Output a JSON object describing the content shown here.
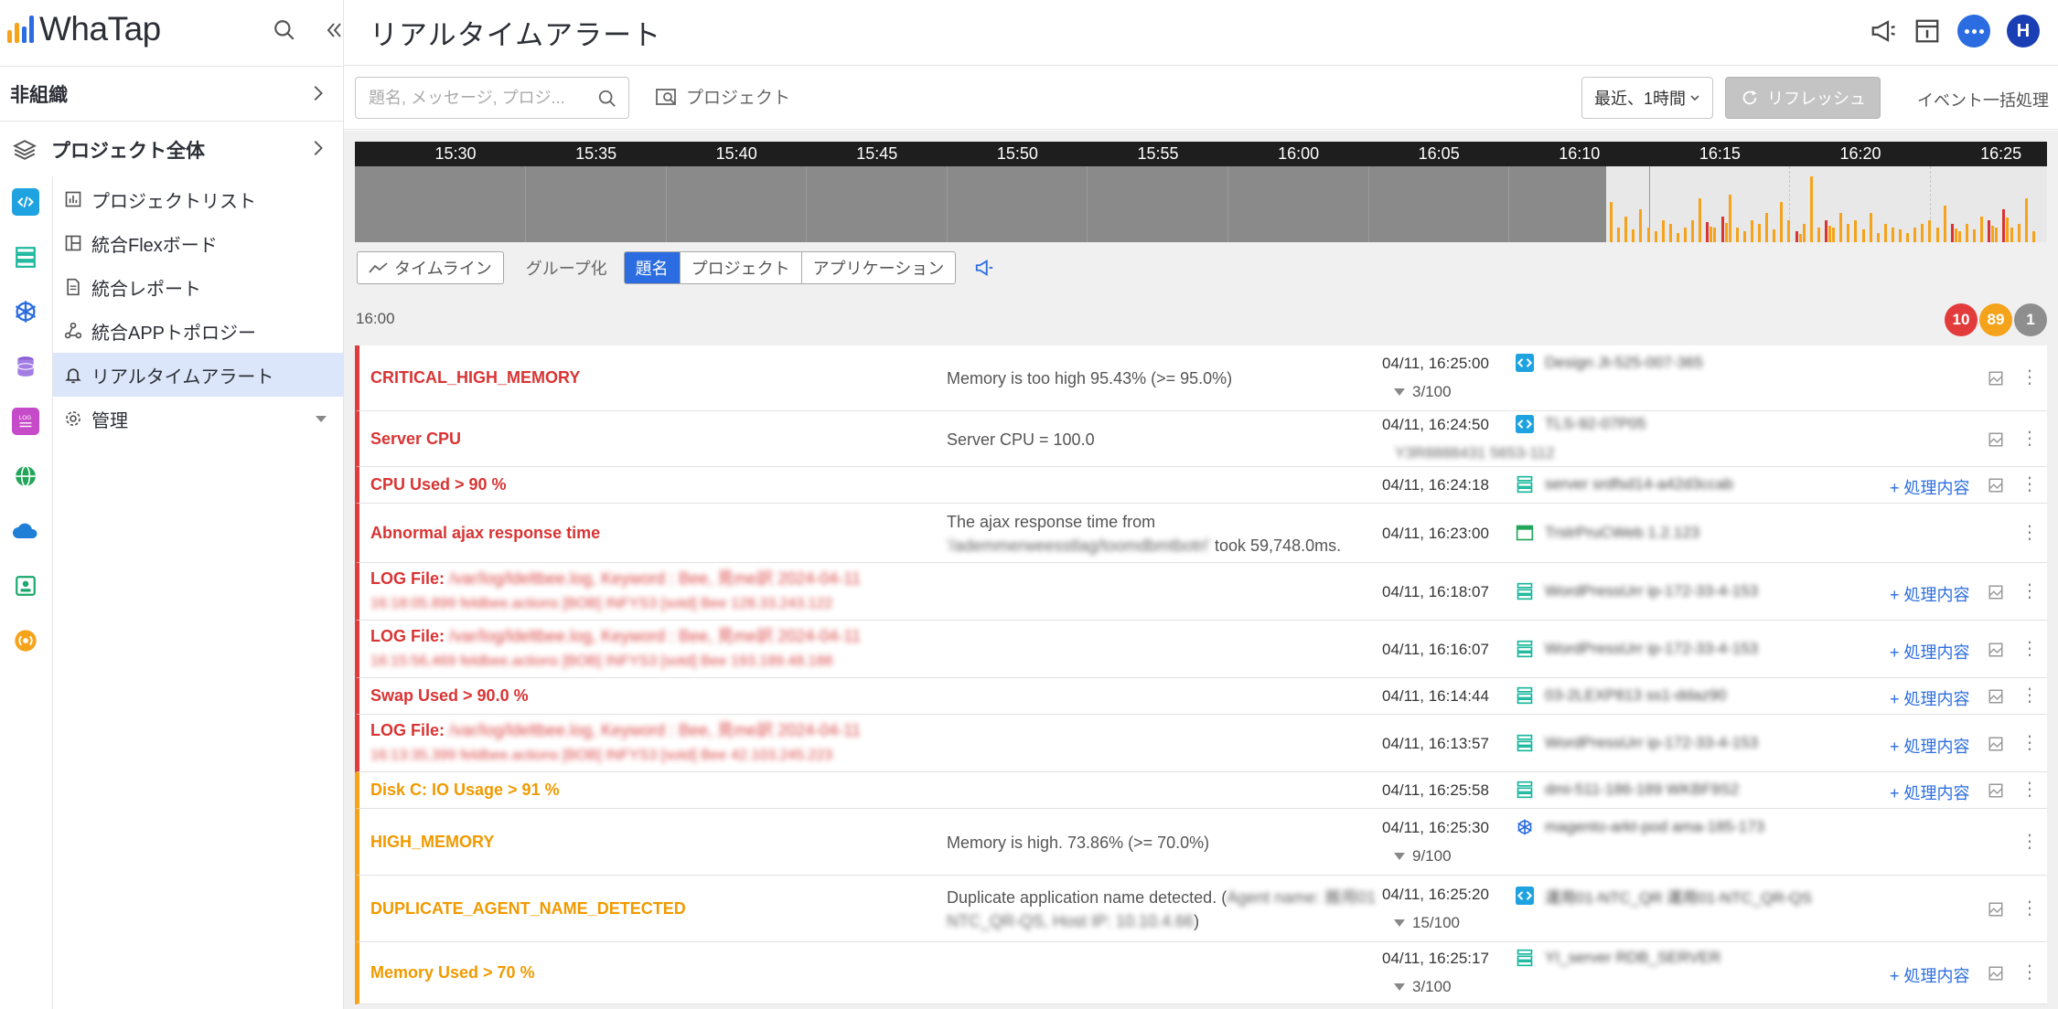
{
  "app": {
    "logo_text": "WhaTap"
  },
  "sidebar": {
    "org_label": "非組織",
    "project_all_label": "プロジェクト全体",
    "menu": [
      {
        "label": "プロジェクトリスト"
      },
      {
        "label": "統合Flexボード"
      },
      {
        "label": "統合レポート"
      },
      {
        "label": "統合APPトポロジー"
      },
      {
        "label": "リアルタイムアラート"
      },
      {
        "label": "管理"
      }
    ]
  },
  "header": {
    "title": "リアルタイムアラート",
    "avatar_initial": "H"
  },
  "toolbar": {
    "search_placeholder": "題名, メッセージ, プロジ...",
    "project_filter_label": "プロジェクト",
    "time_range_label": "最近、1時間",
    "refresh_label": "リフレッシュ",
    "bulk_label": "イベント一括処理"
  },
  "timeline": {
    "ticks": [
      "15:30",
      "15:35",
      "15:40",
      "15:45",
      "15:50",
      "15:55",
      "16:00",
      "16:05",
      "16:10",
      "16:15",
      "16:20",
      "16:25"
    ],
    "mode_label": "タイムライン",
    "group_label": "グループ化",
    "group_options": [
      "題名",
      "プロジェクト",
      "アプリケーション"
    ],
    "group_selected": "題名"
  },
  "group_header": {
    "time": "16:00",
    "critical_count": "10",
    "warning_count": "89",
    "info_count": "1"
  },
  "alerts": [
    {
      "level": "critical",
      "title": "CRITICAL_HIGH_MEMORY",
      "message": "Memory is too high 95.43% (>= 95.0%)",
      "time": "04/11, 16:25:00",
      "count": "3/100",
      "app": "Design   Jt-525-007-365",
      "action": ""
    },
    {
      "level": "critical",
      "title": "Server CPU",
      "message": "Server CPU = 100.0",
      "time": "04/11, 16:24:50",
      "count": "",
      "app": "TLS-92-07P05",
      "app2": "Y3R8888431 5653-112",
      "action": ""
    },
    {
      "level": "critical",
      "title": "CPU Used > 90 %",
      "message": "",
      "time": "04/11, 16:24:18",
      "count": "",
      "app": "server    srdfsd14-a42d3ccab",
      "action": "処理内容"
    },
    {
      "level": "critical",
      "title": "Abnormal ajax response time",
      "message": "The ajax response time from",
      "message_blur": "'/ademmerweesstlag/toomdbmtbotri'",
      "message_tail": " took 59,748.0ms.",
      "time": "04/11, 16:23:00",
      "count": "",
      "app": "TrstrPruCWeb       1.2.123",
      "action": ""
    },
    {
      "level": "critical",
      "title": "LOG File:",
      "title_blur": "/var/log/ldeltbee.log, Keyword : Bee, 見me訳 2024-04-11",
      "title_blur2": "16:18:05.899 feldbee.actions [BOB] INFYS3 [sotd] Bee 128.33.243.122",
      "message": "",
      "time": "04/11, 16:18:07",
      "count": "",
      "app": "WordPressUrr    ip-172-33-4-153",
      "action": "処理内容"
    },
    {
      "level": "critical",
      "title": "LOG File:",
      "title_blur": "/var/log/ldeltbee.log, Keyword : Bee, 見me訳 2024-04-11",
      "title_blur2": "16:15:56,469 feldbee.actions [BOB] INFYS3 [sotd] Bee 193.189.48.188",
      "message": "",
      "time": "04/11, 16:16:07",
      "count": "",
      "app": "WordPressUrr    ip-172-33-4-153",
      "action": "処理内容"
    },
    {
      "level": "critical",
      "title": "Swap Used > 90.0 %",
      "message": "",
      "time": "04/11, 16:14:44",
      "count": "",
      "app": "03-2LEXP813    ss1-ddaz90",
      "action": "処理内容"
    },
    {
      "level": "critical",
      "title": "LOG File:",
      "title_blur": "/var/log/ldeltbee.log, Keyword : Bee, 見me訳 2024-04-11",
      "title_blur2": "16:13:35,399 feldbee.actions [BOB] INFYS3 [sotd] Bee 42.103.245.223",
      "message": "",
      "time": "04/11, 16:13:57",
      "count": "",
      "app": "WordPressUrr    ip-172-33-4-153",
      "action": "処理内容"
    },
    {
      "level": "warning",
      "title": "Disk C: IO Usage > 91 %",
      "message": "",
      "time": "04/11, 16:25:58",
      "count": "",
      "app": "dmi-511-186-189    WKBF9S2",
      "action": "処理内容"
    },
    {
      "level": "warning",
      "title": "HIGH_MEMORY",
      "message": "Memory is high. 73.86% (>= 70.0%)",
      "time": "04/11, 16:25:30",
      "count": "9/100",
      "app": "magento-arkt-pod    ama-185-173",
      "action": ""
    },
    {
      "level": "warning",
      "title": "DUPLICATE_AGENT_NAME_DETECTED",
      "message": "Duplicate application name detected. (",
      "message_blur": "Agent name: 搬用01",
      "message_line2_blur": "NTC_QR-QS, Host IP: 10.10.4.66",
      "message_tail": ")",
      "time": "04/11, 16:25:20",
      "count": "15/100",
      "app": "運用01-NTC_QR   運用01-NTC_QR-QS",
      "action": ""
    },
    {
      "level": "warning",
      "title": "Memory Used > 70 %",
      "message": "",
      "time": "04/11, 16:25:17",
      "count": "3/100",
      "app": "YI_server     RDB_SERVER",
      "action": "処理内容"
    }
  ],
  "colors": {
    "critical": "#d93434",
    "warning": "#f09a00",
    "accent": "#2b6de0",
    "timeline_orange": "#f5a31a",
    "timeline_red": "#d93434"
  },
  "timeline_bars": [
    {
      "v": 0.55,
      "c": "orange"
    },
    {
      "v": 0.2,
      "c": "orange"
    },
    {
      "v": 0.35,
      "c": "orange"
    },
    {
      "v": 0.18,
      "c": "orange"
    },
    {
      "v": 0.45,
      "c": "orange"
    },
    {
      "v": 0.2,
      "c": "orange"
    },
    {
      "v": 0.15,
      "c": "orange"
    },
    {
      "v": 0.3,
      "c": "orange"
    },
    {
      "v": 0.25,
      "c": "orange"
    },
    {
      "v": 0.12,
      "c": "orange"
    },
    {
      "v": 0.2,
      "c": "orange"
    },
    {
      "v": 0.3,
      "c": "orange"
    },
    {
      "v": 0.6,
      "c": "orange"
    },
    {
      "v": 0.28,
      "c": "red"
    },
    {
      "v": 0.2,
      "c": "orange"
    },
    {
      "v": 0.35,
      "c": "red"
    },
    {
      "v": 0.65,
      "c": "orange"
    },
    {
      "v": 0.2,
      "c": "orange"
    },
    {
      "v": 0.15,
      "c": "orange"
    },
    {
      "v": 0.3,
      "c": "orange"
    },
    {
      "v": 0.25,
      "c": "orange"
    },
    {
      "v": 0.4,
      "c": "orange"
    },
    {
      "v": 0.18,
      "c": "orange"
    },
    {
      "v": 0.55,
      "c": "orange"
    },
    {
      "v": 0.3,
      "c": "orange"
    },
    {
      "v": 0.15,
      "c": "red"
    },
    {
      "v": 0.25,
      "c": "orange"
    },
    {
      "v": 0.9,
      "c": "orange"
    },
    {
      "v": 0.2,
      "c": "orange"
    },
    {
      "v": 0.3,
      "c": "red"
    },
    {
      "v": 0.2,
      "c": "orange"
    },
    {
      "v": 0.4,
      "c": "orange"
    },
    {
      "v": 0.25,
      "c": "orange"
    },
    {
      "v": 0.3,
      "c": "orange"
    },
    {
      "v": 0.18,
      "c": "orange"
    },
    {
      "v": 0.4,
      "c": "orange"
    },
    {
      "v": 0.12,
      "c": "orange"
    },
    {
      "v": 0.25,
      "c": "orange"
    },
    {
      "v": 0.2,
      "c": "orange"
    },
    {
      "v": 0.18,
      "c": "orange"
    },
    {
      "v": 0.12,
      "c": "orange"
    },
    {
      "v": 0.2,
      "c": "orange"
    },
    {
      "v": 0.25,
      "c": "orange"
    },
    {
      "v": 0.3,
      "c": "orange"
    },
    {
      "v": 0.2,
      "c": "orange"
    },
    {
      "v": 0.5,
      "c": "orange"
    },
    {
      "v": 0.25,
      "c": "red"
    },
    {
      "v": 0.15,
      "c": "orange"
    },
    {
      "v": 0.25,
      "c": "orange"
    },
    {
      "v": 0.18,
      "c": "orange"
    },
    {
      "v": 0.35,
      "c": "orange"
    },
    {
      "v": 0.3,
      "c": "red"
    },
    {
      "v": 0.2,
      "c": "orange"
    },
    {
      "v": 0.45,
      "c": "red"
    },
    {
      "v": 0.2,
      "c": "orange"
    },
    {
      "v": 0.25,
      "c": "orange"
    },
    {
      "v": 0.6,
      "c": "orange"
    },
    {
      "v": 0.15,
      "c": "orange"
    }
  ]
}
